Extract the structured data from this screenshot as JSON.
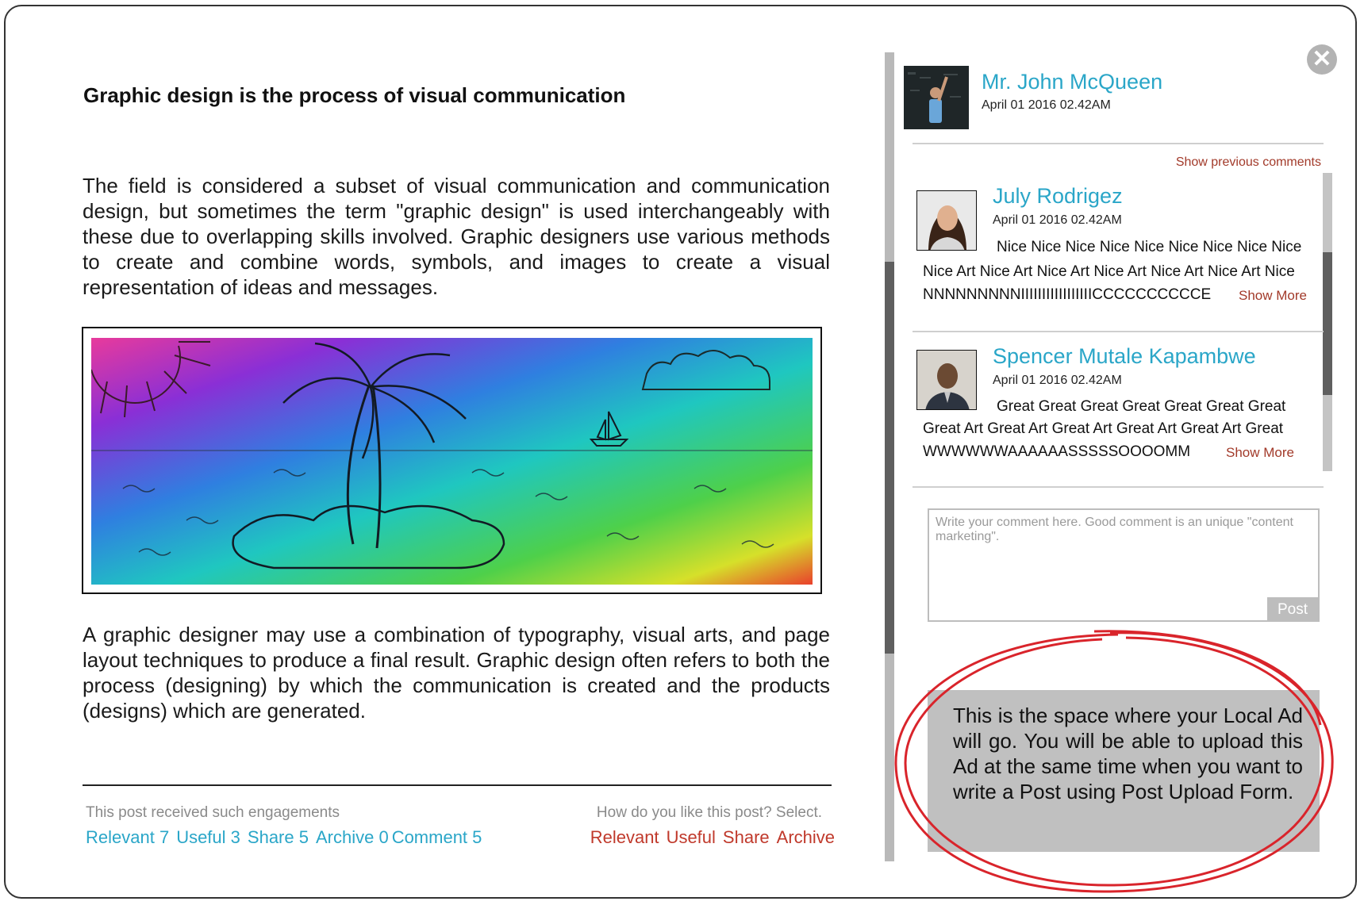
{
  "post": {
    "title": "Graphic design is the process of visual communication",
    "paragraph1": "The field is considered a subset of visual communication and communication design, but sometimes the term \"graphic design\" is used interchangeably with these due to overlapping skills involved. Graphic designers use various methods to create and combine words, symbols, and images to create a visual representation of ideas and messages.",
    "paragraph2": "A graphic designer may use a combination of typography, visual arts, and page layout techniques to produce a final result. Graphic design often refers to both the process (designing) by which the communication is created and the products (designs) which are generated."
  },
  "engagement": {
    "caption": "This post received such engagements",
    "items": [
      "Relevant 7",
      "Useful 3",
      "Share 5",
      "Archive 0",
      "Comment 5"
    ]
  },
  "reaction": {
    "caption": "How do you like this post? Select.",
    "items": [
      "Relevant",
      "Useful",
      "Share",
      "Archive"
    ]
  },
  "author": {
    "name": "Mr. John McQueen",
    "date": "April 01 2016 02.42AM"
  },
  "comments": {
    "show_previous": "Show previous comments",
    "items": [
      {
        "name": "July Rodrigez",
        "date": "April 01 2016 02.42AM",
        "lines": [
          "Nice Nice Nice Nice Nice Nice Nice Nice Nice",
          "Nice Art Nice Art Nice Art Nice Art Nice Art Nice Art Nice",
          "NNNNNNNNNIIIIIIIIIIIIIIIIICCCCCCCCCCE"
        ],
        "show_more": "Show More"
      },
      {
        "name": "Spencer Mutale Kapambwe",
        "date": "April 01 2016 02.42AM",
        "lines": [
          "Great Great Great Great Great Great Great",
          "Great Art Great Art Great Art Great Art Great Art Great",
          "WWWWWWAAAAAASSSSSOOOOMM"
        ],
        "show_more": "Show More"
      }
    ]
  },
  "composer": {
    "placeholder": "Write your comment here. Good comment is an unique \"content marketing\".",
    "post_label": "Post"
  },
  "ad": {
    "text": "This is the space where your Local Ad will go. You will be able to upload this Ad at the same time when you want to write a Post using Post Upload Form."
  },
  "icons": {
    "close": "close-icon"
  },
  "colors": {
    "accent_blue": "#2aa6c8",
    "accent_red": "#c0392b",
    "annotation_red": "#d9242b"
  }
}
